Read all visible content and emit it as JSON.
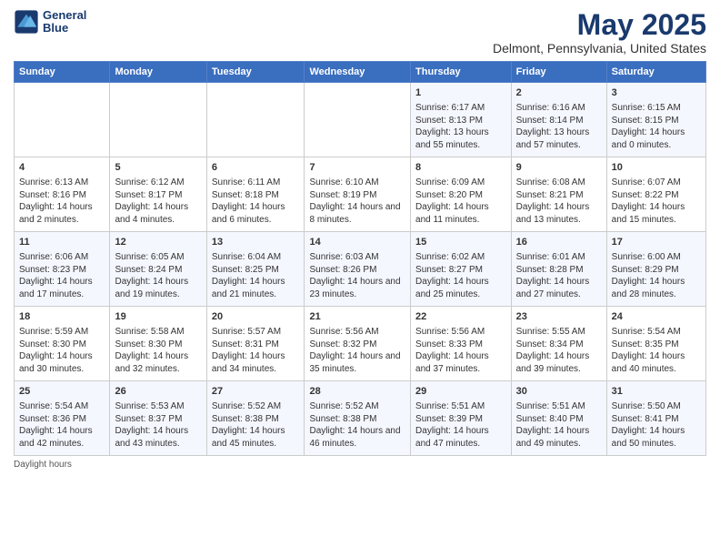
{
  "header": {
    "logo_line1": "General",
    "logo_line2": "Blue",
    "title": "May 2025",
    "subtitle": "Delmont, Pennsylvania, United States"
  },
  "columns": [
    "Sunday",
    "Monday",
    "Tuesday",
    "Wednesday",
    "Thursday",
    "Friday",
    "Saturday"
  ],
  "weeks": [
    [
      {
        "day": "",
        "content": ""
      },
      {
        "day": "",
        "content": ""
      },
      {
        "day": "",
        "content": ""
      },
      {
        "day": "",
        "content": ""
      },
      {
        "day": "1",
        "content": "Sunrise: 6:17 AM\nSunset: 8:13 PM\nDaylight: 13 hours and 55 minutes."
      },
      {
        "day": "2",
        "content": "Sunrise: 6:16 AM\nSunset: 8:14 PM\nDaylight: 13 hours and 57 minutes."
      },
      {
        "day": "3",
        "content": "Sunrise: 6:15 AM\nSunset: 8:15 PM\nDaylight: 14 hours and 0 minutes."
      }
    ],
    [
      {
        "day": "4",
        "content": "Sunrise: 6:13 AM\nSunset: 8:16 PM\nDaylight: 14 hours and 2 minutes."
      },
      {
        "day": "5",
        "content": "Sunrise: 6:12 AM\nSunset: 8:17 PM\nDaylight: 14 hours and 4 minutes."
      },
      {
        "day": "6",
        "content": "Sunrise: 6:11 AM\nSunset: 8:18 PM\nDaylight: 14 hours and 6 minutes."
      },
      {
        "day": "7",
        "content": "Sunrise: 6:10 AM\nSunset: 8:19 PM\nDaylight: 14 hours and 8 minutes."
      },
      {
        "day": "8",
        "content": "Sunrise: 6:09 AM\nSunset: 8:20 PM\nDaylight: 14 hours and 11 minutes."
      },
      {
        "day": "9",
        "content": "Sunrise: 6:08 AM\nSunset: 8:21 PM\nDaylight: 14 hours and 13 minutes."
      },
      {
        "day": "10",
        "content": "Sunrise: 6:07 AM\nSunset: 8:22 PM\nDaylight: 14 hours and 15 minutes."
      }
    ],
    [
      {
        "day": "11",
        "content": "Sunrise: 6:06 AM\nSunset: 8:23 PM\nDaylight: 14 hours and 17 minutes."
      },
      {
        "day": "12",
        "content": "Sunrise: 6:05 AM\nSunset: 8:24 PM\nDaylight: 14 hours and 19 minutes."
      },
      {
        "day": "13",
        "content": "Sunrise: 6:04 AM\nSunset: 8:25 PM\nDaylight: 14 hours and 21 minutes."
      },
      {
        "day": "14",
        "content": "Sunrise: 6:03 AM\nSunset: 8:26 PM\nDaylight: 14 hours and 23 minutes."
      },
      {
        "day": "15",
        "content": "Sunrise: 6:02 AM\nSunset: 8:27 PM\nDaylight: 14 hours and 25 minutes."
      },
      {
        "day": "16",
        "content": "Sunrise: 6:01 AM\nSunset: 8:28 PM\nDaylight: 14 hours and 27 minutes."
      },
      {
        "day": "17",
        "content": "Sunrise: 6:00 AM\nSunset: 8:29 PM\nDaylight: 14 hours and 28 minutes."
      }
    ],
    [
      {
        "day": "18",
        "content": "Sunrise: 5:59 AM\nSunset: 8:30 PM\nDaylight: 14 hours and 30 minutes."
      },
      {
        "day": "19",
        "content": "Sunrise: 5:58 AM\nSunset: 8:30 PM\nDaylight: 14 hours and 32 minutes."
      },
      {
        "day": "20",
        "content": "Sunrise: 5:57 AM\nSunset: 8:31 PM\nDaylight: 14 hours and 34 minutes."
      },
      {
        "day": "21",
        "content": "Sunrise: 5:56 AM\nSunset: 8:32 PM\nDaylight: 14 hours and 35 minutes."
      },
      {
        "day": "22",
        "content": "Sunrise: 5:56 AM\nSunset: 8:33 PM\nDaylight: 14 hours and 37 minutes."
      },
      {
        "day": "23",
        "content": "Sunrise: 5:55 AM\nSunset: 8:34 PM\nDaylight: 14 hours and 39 minutes."
      },
      {
        "day": "24",
        "content": "Sunrise: 5:54 AM\nSunset: 8:35 PM\nDaylight: 14 hours and 40 minutes."
      }
    ],
    [
      {
        "day": "25",
        "content": "Sunrise: 5:54 AM\nSunset: 8:36 PM\nDaylight: 14 hours and 42 minutes."
      },
      {
        "day": "26",
        "content": "Sunrise: 5:53 AM\nSunset: 8:37 PM\nDaylight: 14 hours and 43 minutes."
      },
      {
        "day": "27",
        "content": "Sunrise: 5:52 AM\nSunset: 8:38 PM\nDaylight: 14 hours and 45 minutes."
      },
      {
        "day": "28",
        "content": "Sunrise: 5:52 AM\nSunset: 8:38 PM\nDaylight: 14 hours and 46 minutes."
      },
      {
        "day": "29",
        "content": "Sunrise: 5:51 AM\nSunset: 8:39 PM\nDaylight: 14 hours and 47 minutes."
      },
      {
        "day": "30",
        "content": "Sunrise: 5:51 AM\nSunset: 8:40 PM\nDaylight: 14 hours and 49 minutes."
      },
      {
        "day": "31",
        "content": "Sunrise: 5:50 AM\nSunset: 8:41 PM\nDaylight: 14 hours and 50 minutes."
      }
    ]
  ],
  "footer": "Daylight hours"
}
